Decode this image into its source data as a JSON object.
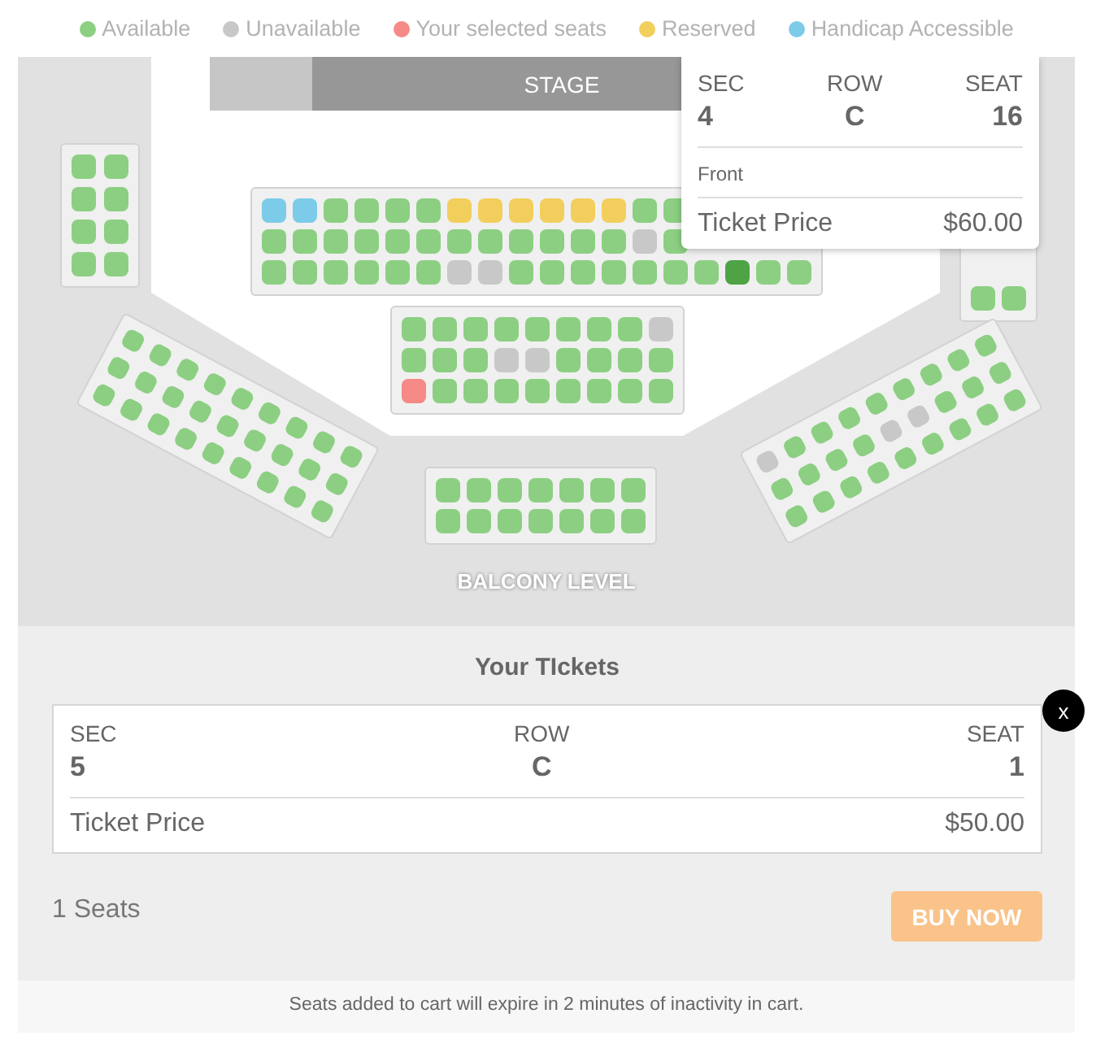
{
  "legend": [
    {
      "label": "Available",
      "color": "#8ccf82"
    },
    {
      "label": "Unavailable",
      "color": "#c8c8c8"
    },
    {
      "label": "Your selected seats",
      "color": "#f58a87"
    },
    {
      "label": "Reserved",
      "color": "#f2cf5d"
    },
    {
      "label": "Handicap Accessible",
      "color": "#7ccbe8"
    }
  ],
  "stage": {
    "label": "STAGE"
  },
  "sections": [
    {
      "rows": [
        {
          "seats": [
            {
              "kind": "available"
            },
            {
              "kind": "available"
            }
          ]
        },
        {
          "seats": [
            {
              "kind": "available"
            },
            {
              "kind": "available"
            }
          ]
        },
        {
          "seats": [
            {
              "kind": "available"
            },
            {
              "kind": "available"
            }
          ]
        },
        {
          "seats": [
            {
              "kind": "available"
            },
            {
              "kind": "available"
            }
          ]
        }
      ]
    },
    {
      "rows": [
        {
          "seats": [
            {
              "kind": "accessible"
            },
            {
              "kind": "accessible"
            },
            {
              "kind": "available"
            },
            {
              "kind": "available"
            },
            {
              "kind": "available"
            },
            {
              "kind": "available"
            },
            {
              "kind": "reserved"
            },
            {
              "kind": "reserved"
            },
            {
              "kind": "reserved"
            },
            {
              "kind": "reserved"
            },
            {
              "kind": "reserved"
            },
            {
              "kind": "reserved"
            },
            {
              "kind": "available"
            },
            {
              "kind": "available"
            }
          ]
        },
        {
          "seats": [
            {
              "kind": "available"
            },
            {
              "kind": "available"
            },
            {
              "kind": "available"
            },
            {
              "kind": "available"
            },
            {
              "kind": "available"
            },
            {
              "kind": "available"
            },
            {
              "kind": "available"
            },
            {
              "kind": "available"
            },
            {
              "kind": "available"
            },
            {
              "kind": "available"
            },
            {
              "kind": "available"
            },
            {
              "kind": "available"
            },
            {
              "kind": "unavailable"
            },
            {
              "kind": "available"
            }
          ]
        },
        {
          "seats": [
            {
              "kind": "available"
            },
            {
              "kind": "available"
            },
            {
              "kind": "available"
            },
            {
              "kind": "available"
            },
            {
              "kind": "available"
            },
            {
              "kind": "available"
            },
            {
              "kind": "unavailable"
            },
            {
              "kind": "unavailable"
            },
            {
              "kind": "available"
            },
            {
              "kind": "available"
            },
            {
              "kind": "available"
            },
            {
              "kind": "available"
            },
            {
              "kind": "available"
            },
            {
              "kind": "available"
            },
            {
              "kind": "available"
            },
            {
              "kind": "highlighted"
            },
            {
              "kind": "available"
            },
            {
              "kind": "available"
            }
          ]
        }
      ]
    },
    {
      "rows": [
        {
          "seats": [
            {
              "kind": "available"
            },
            {
              "kind": "available"
            }
          ]
        }
      ]
    },
    {
      "rows": [
        {
          "seats": [
            {
              "kind": "available"
            },
            {
              "kind": "available"
            },
            {
              "kind": "available"
            },
            {
              "kind": "available"
            },
            {
              "kind": "available"
            },
            {
              "kind": "available"
            },
            {
              "kind": "available"
            },
            {
              "kind": "available"
            },
            {
              "kind": "unavailable"
            }
          ]
        },
        {
          "seats": [
            {
              "kind": "available"
            },
            {
              "kind": "available"
            },
            {
              "kind": "available"
            },
            {
              "kind": "unavailable"
            },
            {
              "kind": "unavailable"
            },
            {
              "kind": "available"
            },
            {
              "kind": "available"
            },
            {
              "kind": "available"
            },
            {
              "kind": "available"
            }
          ]
        },
        {
          "seats": [
            {
              "kind": "selected"
            },
            {
              "kind": "available"
            },
            {
              "kind": "available"
            },
            {
              "kind": "available"
            },
            {
              "kind": "available"
            },
            {
              "kind": "available"
            },
            {
              "kind": "available"
            },
            {
              "kind": "available"
            },
            {
              "kind": "available"
            }
          ]
        }
      ]
    },
    {
      "rows": [
        {
          "seats": [
            {
              "kind": "available"
            },
            {
              "kind": "available"
            },
            {
              "kind": "available"
            },
            {
              "kind": "available"
            },
            {
              "kind": "available"
            },
            {
              "kind": "available"
            },
            {
              "kind": "available"
            }
          ]
        },
        {
          "seats": [
            {
              "kind": "available"
            },
            {
              "kind": "available"
            },
            {
              "kind": "available"
            },
            {
              "kind": "available"
            },
            {
              "kind": "available"
            },
            {
              "kind": "available"
            },
            {
              "kind": "available"
            }
          ]
        }
      ]
    },
    {
      "rows": [
        {
          "seats": [
            {
              "kind": "available"
            },
            {
              "kind": "available"
            },
            {
              "kind": "available"
            },
            {
              "kind": "available"
            },
            {
              "kind": "available"
            },
            {
              "kind": "available"
            },
            {
              "kind": "available"
            },
            {
              "kind": "available"
            },
            {
              "kind": "available"
            }
          ]
        },
        {
          "seats": [
            {
              "kind": "available"
            },
            {
              "kind": "available"
            },
            {
              "kind": "available"
            },
            {
              "kind": "available"
            },
            {
              "kind": "available"
            },
            {
              "kind": "available"
            },
            {
              "kind": "available"
            },
            {
              "kind": "available"
            },
            {
              "kind": "available"
            }
          ]
        },
        {
          "seats": [
            {
              "kind": "available"
            },
            {
              "kind": "available"
            },
            {
              "kind": "available"
            },
            {
              "kind": "available"
            },
            {
              "kind": "available"
            },
            {
              "kind": "available"
            },
            {
              "kind": "available"
            },
            {
              "kind": "available"
            },
            {
              "kind": "available"
            }
          ]
        }
      ]
    },
    {
      "rows": [
        {
          "seats": [
            {
              "kind": "unavailable"
            },
            {
              "kind": "available"
            },
            {
              "kind": "available"
            },
            {
              "kind": "available"
            },
            {
              "kind": "available"
            },
            {
              "kind": "available"
            },
            {
              "kind": "available"
            },
            {
              "kind": "available"
            },
            {
              "kind": "available"
            }
          ]
        },
        {
          "seats": [
            {
              "kind": "available"
            },
            {
              "kind": "available"
            },
            {
              "kind": "available"
            },
            {
              "kind": "available"
            },
            {
              "kind": "unavailable"
            },
            {
              "kind": "unavailable"
            },
            {
              "kind": "available"
            },
            {
              "kind": "available"
            },
            {
              "kind": "available"
            }
          ]
        },
        {
          "seats": [
            {
              "kind": "available"
            },
            {
              "kind": "available"
            },
            {
              "kind": "available"
            },
            {
              "kind": "available"
            },
            {
              "kind": "available"
            },
            {
              "kind": "available"
            },
            {
              "kind": "available"
            },
            {
              "kind": "available"
            },
            {
              "kind": "available"
            }
          ]
        }
      ]
    }
  ],
  "level_label": "BALCONY LEVEL",
  "tooltip": {
    "fields": [
      {
        "label": "SEC",
        "value": "4"
      },
      {
        "label": "ROW",
        "value": "C"
      },
      {
        "label": "SEAT",
        "value": "16"
      }
    ],
    "note": "Front",
    "price_label": "Ticket Price",
    "price": "$60.00"
  },
  "tickets": {
    "title": "Your TIckets",
    "items": [
      {
        "fields": [
          {
            "label": "SEC",
            "value": "5"
          },
          {
            "label": "ROW",
            "value": "C"
          },
          {
            "label": "SEAT",
            "value": "1"
          }
        ],
        "price_label": "Ticket Price",
        "price": "$50.00",
        "remove": "x"
      }
    ],
    "count": "1 Seats",
    "buy_button": "BUY NOW"
  },
  "footer": "Seats added to cart will expire in 2 minutes of inactivity in cart."
}
